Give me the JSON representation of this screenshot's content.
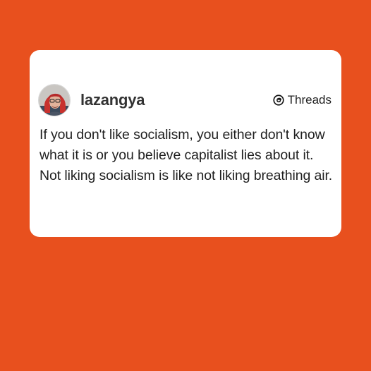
{
  "colors": {
    "background": "#E8501E",
    "card": "#FFFFFF",
    "text": "#1F1F1F"
  },
  "post": {
    "author": {
      "username": "lazangya",
      "avatar_icon": "profile-photo"
    },
    "platform": {
      "name": "Threads",
      "icon": "threads-logo-icon"
    },
    "text": "If you don't like socialism, you either don't know what it is or you believe capitalist lies about it. Not liking socialism is like not liking breathing air."
  }
}
